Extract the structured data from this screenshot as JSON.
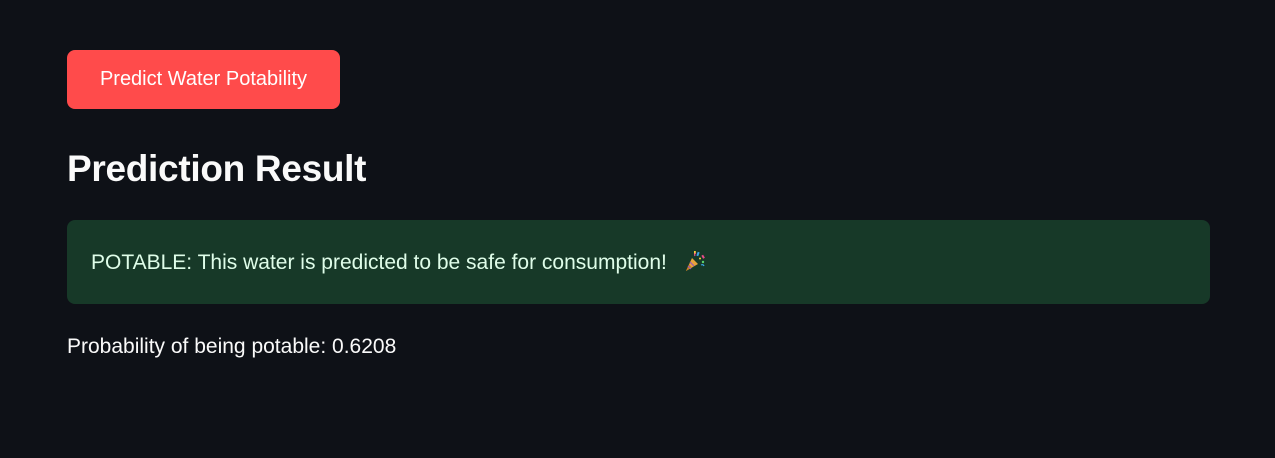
{
  "actions": {
    "predict_button_label": "Predict Water Potability"
  },
  "result": {
    "heading": "Prediction Result",
    "alert_message": "POTABLE: This water is predicted to be safe for consumption!",
    "alert_icon": "party-popper-icon",
    "probability_label": "Probability of being potable:",
    "probability_value": "0.6208"
  },
  "colors": {
    "background": "#0e1117",
    "primary_button": "#ff4b4b",
    "success_bg": "#173928",
    "success_text": "#dffde9"
  }
}
